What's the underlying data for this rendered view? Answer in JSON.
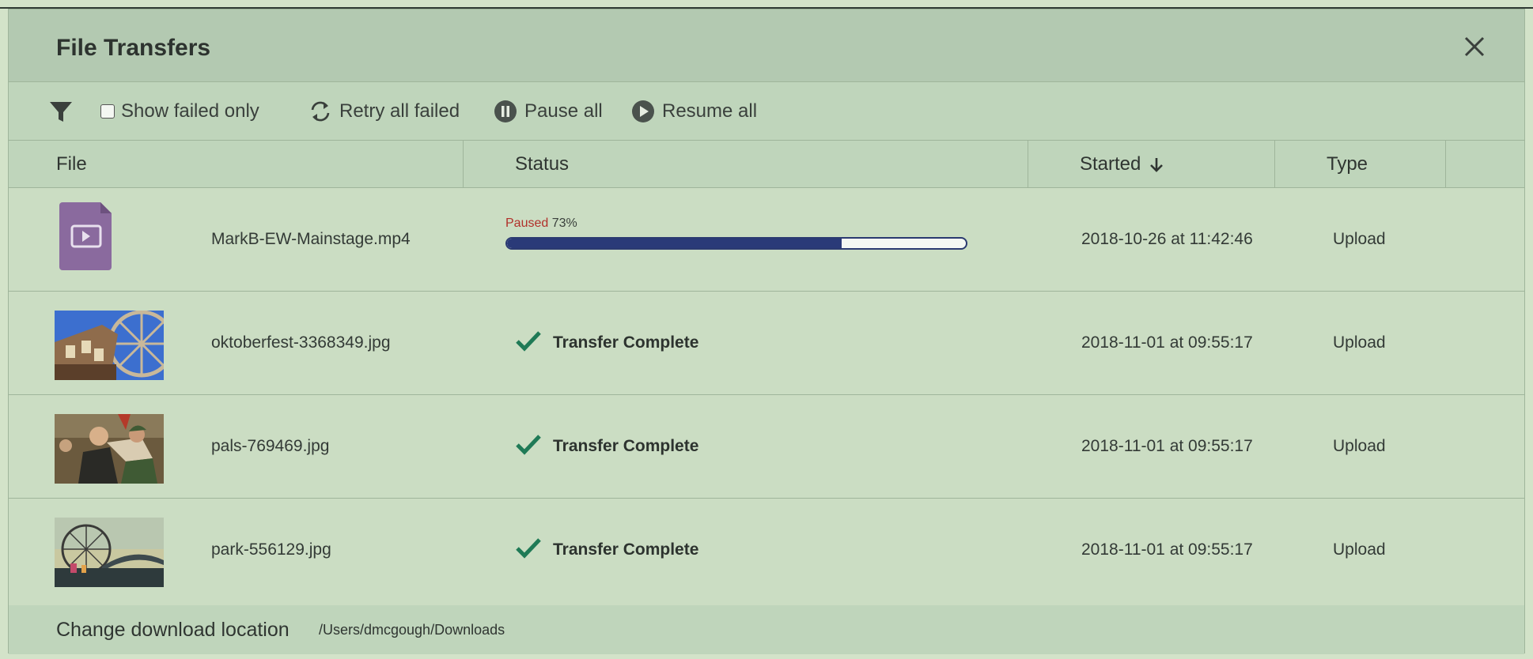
{
  "dialog": {
    "title": "File Transfers"
  },
  "toolbar": {
    "show_failed_label": "Show failed only",
    "retry_label": "Retry all failed",
    "pause_label": "Pause all",
    "resume_label": "Resume all"
  },
  "columns": {
    "file": "File",
    "status": "Status",
    "started": "Started",
    "type": "Type"
  },
  "rows": [
    {
      "file": "MarkB-EW-Mainstage.mp4",
      "status_state": "Paused",
      "status_percent": "73%",
      "progress": 0.73,
      "started": "2018-10-26 at 11:42:46",
      "type": "Upload",
      "thumb": "video-file-icon"
    },
    {
      "file": "oktoberfest-3368349.jpg",
      "status": "Transfer Complete",
      "started": "2018-11-01 at 09:55:17",
      "type": "Upload",
      "thumb": "image-thumbnail"
    },
    {
      "file": "pals-769469.jpg",
      "status": "Transfer Complete",
      "started": "2018-11-01 at 09:55:17",
      "type": "Upload",
      "thumb": "image-thumbnail"
    },
    {
      "file": "park-556129.jpg",
      "status": "Transfer Complete",
      "started": "2018-11-01 at 09:55:17",
      "type": "Upload",
      "thumb": "image-thumbnail"
    }
  ],
  "footer": {
    "link": "Change download location",
    "path": "/Users/dmcgough/Downloads"
  },
  "colors": {
    "paused": "#b1302a",
    "progress": "#2a3a78",
    "check": "#1f7a56",
    "video_icon": "#8a6a9e"
  }
}
